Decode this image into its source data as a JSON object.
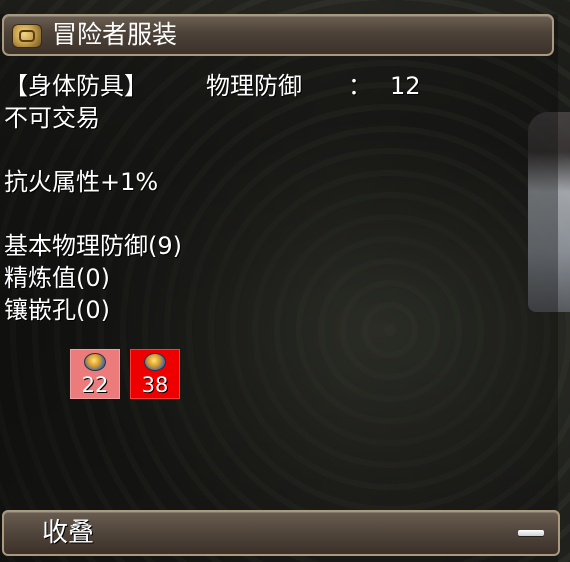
{
  "window": {
    "title": "冒险者服装"
  },
  "item": {
    "armor_type": "【身体防具】",
    "defense_label": "物理防御",
    "defense_colon": "：",
    "defense_value": "12",
    "trade_status": "不可交易",
    "attribute": "抗火属性+1%",
    "base_defense": "基本物理防御(9)",
    "refine": "精炼值(0)",
    "sockets": "镶嵌孔(0)"
  },
  "gems": [
    {
      "icon": "gem-icon",
      "count": "22",
      "color": "#ec7b7b"
    },
    {
      "icon": "gem-icon",
      "count": "38",
      "color": "#ee0000"
    }
  ],
  "footer": {
    "collapse_label": "收叠",
    "minus_icon": "minus-icon"
  },
  "colors": {
    "frame_border": "#a9997f",
    "frame_fill": "#50453b"
  }
}
